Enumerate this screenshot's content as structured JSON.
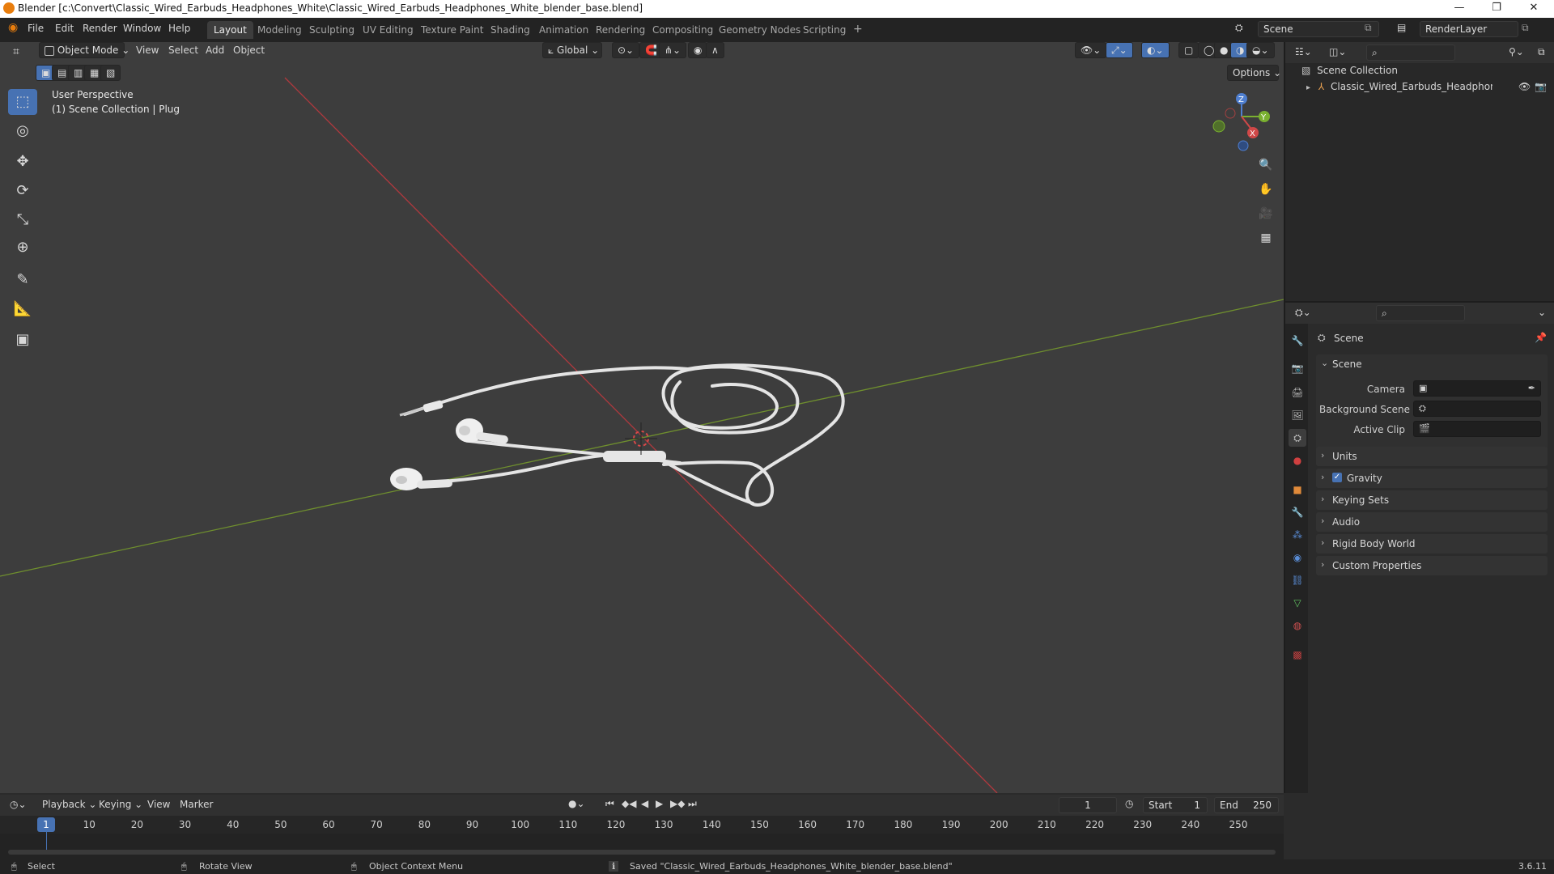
{
  "window": {
    "title": "Blender [c:\\Convert\\Classic_Wired_Earbuds_Headphones_White\\Classic_Wired_Earbuds_Headphones_White_blender_base.blend]",
    "minimize": "—",
    "maximize": "❐",
    "close": "✕"
  },
  "menu": [
    "File",
    "Edit",
    "Render",
    "Window",
    "Help"
  ],
  "workspaces": [
    "Layout",
    "Modeling",
    "Sculpting",
    "UV Editing",
    "Texture Paint",
    "Shading",
    "Animation",
    "Rendering",
    "Compositing",
    "Geometry Nodes",
    "Scripting"
  ],
  "workspace_add": "+",
  "scene_selector": {
    "value": "Scene"
  },
  "view_layer_selector": {
    "value": "RenderLayer"
  },
  "viewport": {
    "mode": "Object Mode",
    "menus": [
      "View",
      "Select",
      "Add",
      "Object"
    ],
    "transform_orientation": "Global",
    "options_label": "Options",
    "perspective_label": "User Perspective",
    "collection_label": "(1) Scene Collection | Plug",
    "gizmo": {
      "x": "X",
      "y": "Y",
      "z": "Z"
    },
    "icons": {
      "zoom": "🔍",
      "pan": "✋",
      "camera": "🎥",
      "grid": "▦"
    }
  },
  "toolbar": {
    "tools": [
      "select-box",
      "cursor",
      "move",
      "rotate",
      "scale",
      "transform",
      "annotate",
      "measure",
      "add-cube"
    ],
    "glyphs": [
      "⬚",
      "◎",
      "✥",
      "⟳",
      "⤡",
      "⊕",
      "✎",
      "📐",
      "▣"
    ]
  },
  "outliner": {
    "search_placeholder": "",
    "root": "Scene Collection",
    "items": [
      {
        "label": "Classic_Wired_Earbuds_Headphones_Wh"
      }
    ]
  },
  "properties": {
    "search_placeholder": "",
    "context_title": "Scene",
    "scene_panel": {
      "title": "Scene",
      "camera_label": "Camera",
      "background_scene_label": "Background Scene",
      "active_clip_label": "Active Clip"
    },
    "collapsed_panels": [
      "Units",
      "Gravity",
      "Keying Sets",
      "Audio",
      "Rigid Body World",
      "Custom Properties"
    ],
    "gravity_checked": true,
    "tab_colors": [
      "#9a9a9a",
      "#c8c8c8",
      "#b8b8b8",
      "#b8b8b8",
      "#c8c8c8",
      "#d04040",
      "#e08a3a",
      "#5a8ed8",
      "#5a8ed8",
      "#5a8ed8",
      "#5a8ed8",
      "#60c060",
      "#d05050",
      "#c04040"
    ]
  },
  "timeline": {
    "menus": [
      "Playback",
      "Keying",
      "View",
      "Marker"
    ],
    "current_frame": "1",
    "start_label": "Start",
    "start_value": "1",
    "end_label": "End",
    "end_value": "250",
    "ruler_current": "1",
    "ticks": [
      "10",
      "20",
      "30",
      "40",
      "50",
      "60",
      "70",
      "80",
      "90",
      "100",
      "110",
      "120",
      "130",
      "140",
      "150",
      "160",
      "170",
      "180",
      "190",
      "200",
      "210",
      "220",
      "230",
      "240",
      "250"
    ]
  },
  "statusbar": {
    "select": "Select",
    "rotate_view": "Rotate View",
    "context_menu": "Object Context Menu",
    "message": "Saved \"Classic_Wired_Earbuds_Headphones_White_blender_base.blend\"",
    "version": "3.6.11"
  }
}
